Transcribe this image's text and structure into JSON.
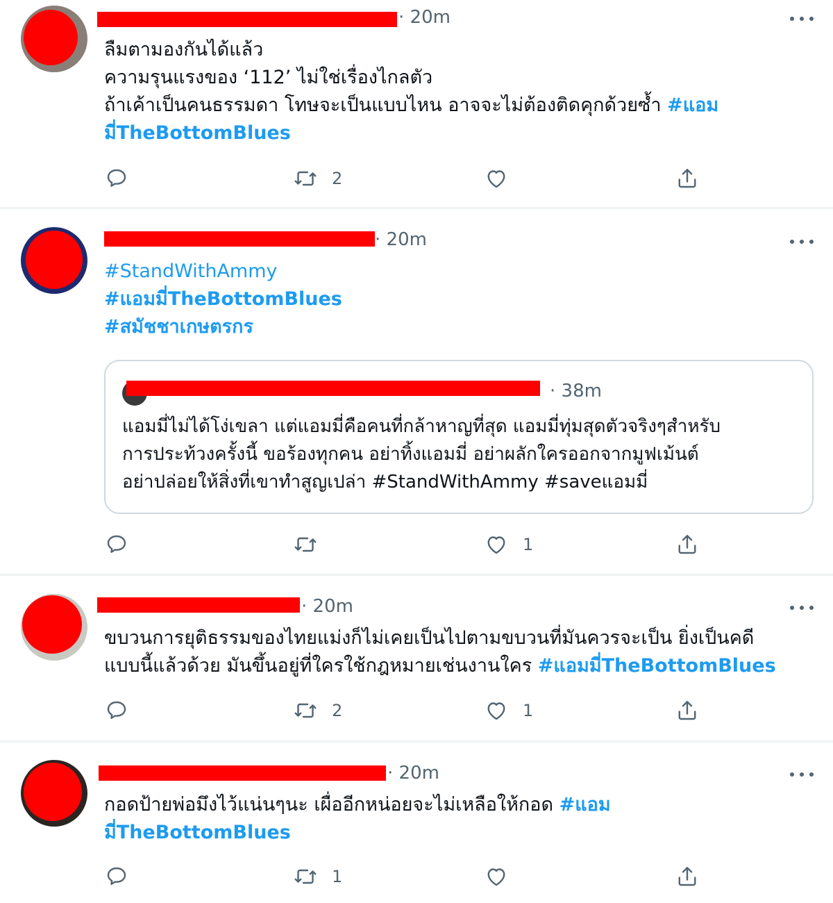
{
  "tweets": [
    {
      "time": "· 20m",
      "lines": [
        {
          "text": "ลืมตามองกันได้แล้ว"
        },
        {
          "text": "ความรุนแรงของ ‘112’ ไม่ใช่เรื่องไกลตัว"
        },
        {
          "text": "ถ้าเค้าเป็นคนธรรมดา โทษจะเป็นแบบไหน อาจจะไม่ต้องติดคุกด้วยซ้ำ ",
          "tag": "#แอม"
        },
        {
          "tag": "มี่TheBottomBlues"
        }
      ],
      "reply_count": "",
      "retweet_count": "2",
      "like_count": ""
    },
    {
      "time": "· 20m",
      "lines": [
        {
          "tag_plain": "#StandWithAmmy"
        },
        {
          "tag": "#แอมมี่TheBottomBlues"
        },
        {
          "tag": "#สมัชชาเกษตรกร"
        }
      ],
      "quote": {
        "time": "· 38m",
        "lines": [
          "แอมมี่ไม่ได้โง่เขลา แต่แอมมี่คือคนที่กล้าหาญที่สุด แอมมี่ทุ่มสุดตัวจริงๆสำหรับ",
          "การประท้วงครั้งนี้ ขอร้องทุกคน อย่าทิ้งแอมมี่ อย่าผลักใครออกจากมูฟเม้นต์",
          "อย่าปล่อยให้สิ่งที่เขาทำสูญเปล่า #StandWithAmmy #saveแอมมี่"
        ]
      },
      "reply_count": "",
      "retweet_count": "",
      "like_count": "1"
    },
    {
      "time": "· 20m",
      "lines": [
        {
          "text": "ขบวนการยุติธรรมของไทยแม่งก็ไม่เคยเป็นไปตามขบวนที่มันควรจะเป็น ยิ่งเป็นคดี"
        },
        {
          "text": "แบบนี้แล้วด้วย มันขึ้นอยู่ที่ใครใช้กฎหมายเช่นงานใคร  ",
          "tag": "#แอมมี่TheBottomBlues"
        }
      ],
      "reply_count": "",
      "retweet_count": "2",
      "like_count": "1"
    },
    {
      "time": "· 20m",
      "lines": [
        {
          "text": "กอดป้ายพ่อมึงไว้แน่นๆนะ เผื่ออีกหน่อยจะไม่เหลือให้กอด ",
          "tag": "#แอม"
        },
        {
          "tag": "มี่TheBottomBlues"
        }
      ],
      "reply_count": "",
      "retweet_count": "1",
      "like_count": ""
    }
  ],
  "icons": {
    "reply": "reply-icon",
    "retweet": "retweet-icon",
    "like": "heart-icon",
    "share": "share-icon",
    "more": "more-icon"
  },
  "colors": {
    "hashtag": "#1d9bf0",
    "redaction": "#ff0000",
    "muted": "#536471"
  }
}
